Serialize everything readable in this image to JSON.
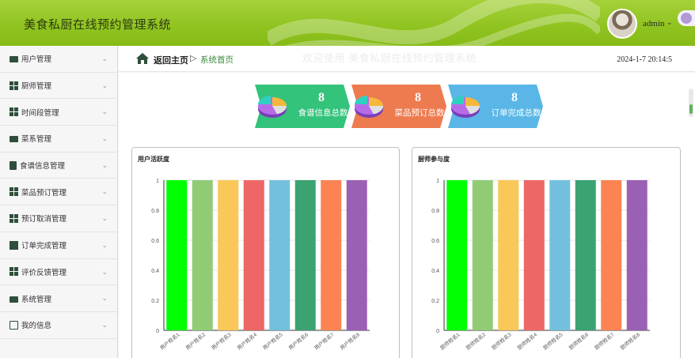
{
  "app": {
    "title": "美食私厨在线预约管理系统"
  },
  "user": {
    "name": "admin",
    "caret": "⌄"
  },
  "sidebar": {
    "items": [
      {
        "label": "用户管理",
        "icon": "briefcase-icon"
      },
      {
        "label": "厨师管理",
        "icon": "grid-icon"
      },
      {
        "label": "时间段管理",
        "icon": "grid-icon"
      },
      {
        "label": "菜系管理",
        "icon": "monitor-icon"
      },
      {
        "label": "食谱信息管理",
        "icon": "clipboard-icon"
      },
      {
        "label": "菜品预订管理",
        "icon": "grid-icon"
      },
      {
        "label": "预订取消管理",
        "icon": "grid-icon"
      },
      {
        "label": "订单完成管理",
        "icon": "book-icon"
      },
      {
        "label": "评价反馈管理",
        "icon": "grid-icon"
      },
      {
        "label": "系统管理",
        "icon": "pin-icon"
      },
      {
        "label": "我的信息",
        "icon": "calendar-icon"
      }
    ]
  },
  "breadcrumb": {
    "home": "返回主页",
    "separator": "▷",
    "current": "系统首页"
  },
  "welcome": "欢迎使用 美食私厨在线预约管理系统",
  "datetime": "2024-1-7 20:14:5",
  "stats": [
    {
      "value": "8",
      "label": "食谱信息总数",
      "color": "#33c37a"
    },
    {
      "value": "8",
      "label": "菜品预订总数",
      "color": "#ee7b4f"
    },
    {
      "value": "8",
      "label": "订单完成总数",
      "color": "#5ab6e7"
    }
  ],
  "charts_meta": {
    "colors": [
      "#00ff00",
      "#91cc75",
      "#fac858",
      "#ee6666",
      "#73c0de",
      "#3ba272",
      "#fc8452",
      "#9a60b4"
    ]
  },
  "chart_data": [
    {
      "type": "bar",
      "title": "用户活跃度",
      "categories": [
        "用户姓名1",
        "用户姓名2",
        "用户姓名3",
        "用户姓名4",
        "用户姓名5",
        "用户姓名6",
        "用户姓名7",
        "用户姓名8"
      ],
      "values": [
        1,
        1,
        1,
        1,
        1,
        1,
        1,
        1
      ],
      "yticks": [
        "0",
        "0.2",
        "0.4",
        "0.6",
        "0.8",
        "1"
      ],
      "ylim": [
        0,
        1
      ],
      "grid": true
    },
    {
      "type": "bar",
      "title": "厨师参与度",
      "categories": [
        "厨师姓名1",
        "厨师姓名2",
        "厨师姓名3",
        "厨师姓名4",
        "厨师姓名5",
        "厨师姓名6",
        "厨师姓名7",
        "厨师姓名8"
      ],
      "values": [
        1,
        1,
        1,
        1,
        1,
        1,
        1,
        1
      ],
      "yticks": [
        "0",
        "0.2",
        "0.4",
        "0.6",
        "0.8",
        "1"
      ],
      "ylim": [
        0,
        1
      ],
      "grid": true
    }
  ]
}
